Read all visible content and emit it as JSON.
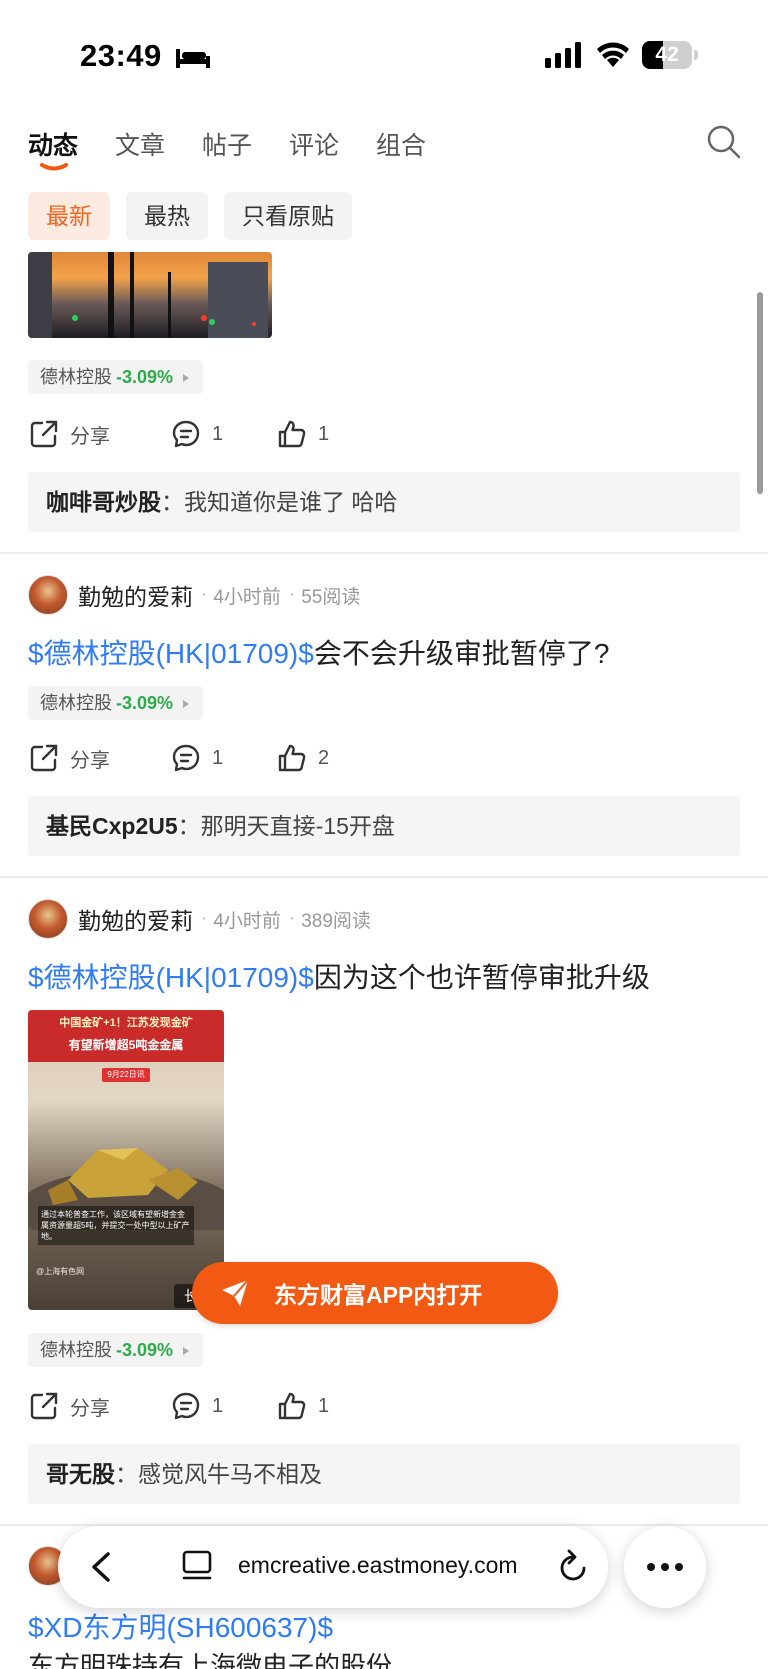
{
  "status": {
    "time": "23:49",
    "battery": "42",
    "battery_level": 0.42,
    "icons": [
      "sleep-icon",
      "signal-icon",
      "wifi-icon",
      "battery-icon"
    ]
  },
  "tabs": [
    {
      "label": "动态",
      "active": true
    },
    {
      "label": "文章",
      "active": false
    },
    {
      "label": "帖子",
      "active": false
    },
    {
      "label": "评论",
      "active": false
    },
    {
      "label": "组合",
      "active": false
    }
  ],
  "filters": [
    {
      "label": "最新",
      "active": true
    },
    {
      "label": "最热",
      "active": false
    },
    {
      "label": "只看原贴",
      "active": false
    }
  ],
  "accent_color": "#f25a14",
  "link_color": "#2f7cf6",
  "gain_color": "#2eaa4b",
  "posts": [
    {
      "stock_tag": {
        "name": "德林控股",
        "change": "-3.09%"
      },
      "share_label": "分享",
      "comment_count": "1",
      "like_count": "1",
      "comment": {
        "user": "咖啡哥炒股",
        "sep": "：",
        "text": "我知道你是谁了 哈哈"
      }
    },
    {
      "author": "勤勉的爱莉",
      "time": "4小时前",
      "reads": "55阅读",
      "title_link": "$德林控股(HK|01709)$",
      "title_text": "会不会升级审批暂停了?",
      "stock_tag": {
        "name": "德林控股",
        "change": "-3.09%"
      },
      "share_label": "分享",
      "comment_count": "1",
      "like_count": "2",
      "comment": {
        "user": "基民Cxp2U5",
        "sep": "：",
        "text": "那明天直接-15开盘"
      }
    },
    {
      "author": "勤勉的爱莉",
      "time": "4小时前",
      "reads": "389阅读",
      "title_link": "$德林控股(HK|01709)$",
      "title_text": "因为这个也许暂停审批升级",
      "image_caption": {
        "line1": "中国金矿+1！江苏发现金矿",
        "line2": "有望新增超5吨金金属",
        "date": "9月22日讯",
        "body": "通过本轮普查工作，该区域有望新增金金属资源量超5吨，并提交一处中型以上矿产地。",
        "source": "@上海有色网",
        "tag": "长"
      },
      "stock_tag": {
        "name": "德林控股",
        "change": "-3.09%"
      },
      "share_label": "分享",
      "comment_count": "1",
      "like_count": "1",
      "comment": {
        "user": "哥无股",
        "sep": "：",
        "text": "感觉风牛马不相及"
      }
    }
  ],
  "bottom_post": {
    "title_link": "$XD东方明(SH600637)$",
    "body": "东方明珠持有上海微电子的股份"
  },
  "open_app_label": "东方财富APP内打开",
  "browser": {
    "url": "emcreative.eastmoney.com"
  }
}
